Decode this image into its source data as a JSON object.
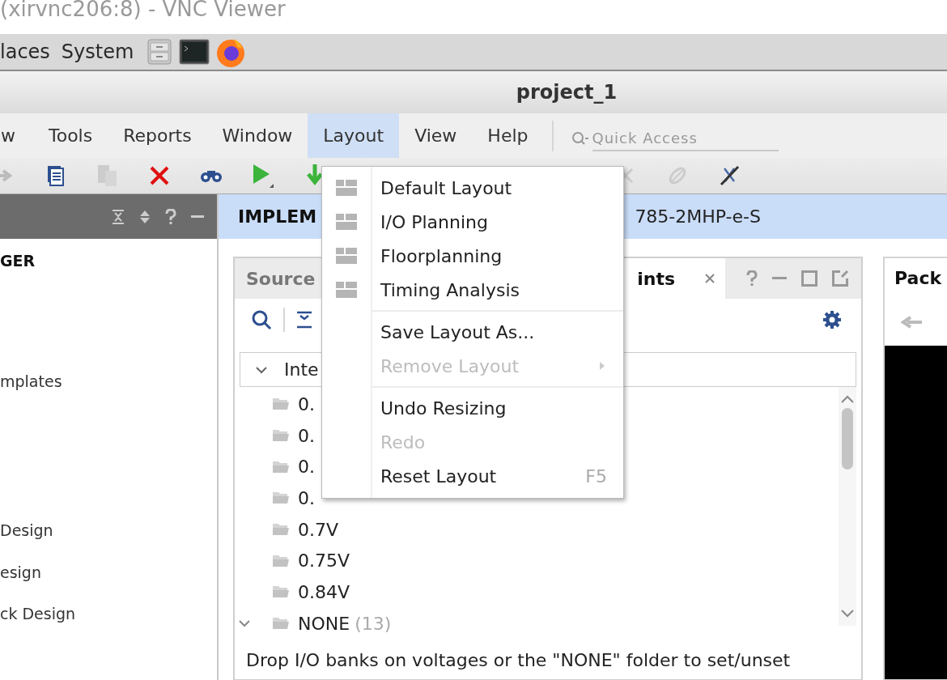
{
  "viewer_title": "(xirvnc206:8) - VNC Viewer",
  "panel_menu": [
    "laces",
    "System"
  ],
  "app_title": "project_1",
  "menubar": [
    {
      "label": "w",
      "selected": false
    },
    {
      "label": "Tools",
      "selected": false
    },
    {
      "label": "Reports",
      "selected": false
    },
    {
      "label": "Window",
      "selected": false
    },
    {
      "label": "Layout",
      "selected": true
    },
    {
      "label": "View",
      "selected": false
    },
    {
      "label": "Help",
      "selected": false
    }
  ],
  "quick_access": {
    "placeholder": "Quick Access"
  },
  "flow_navigator": {
    "items": [
      {
        "kind": "heading",
        "label": "GER"
      },
      {
        "kind": "item",
        "label": "mplates"
      },
      {
        "kind": "item",
        "label": "Design"
      },
      {
        "kind": "item",
        "label": "esign"
      },
      {
        "kind": "item",
        "label": "ck Design"
      }
    ]
  },
  "banner": {
    "left": "IMPLEM",
    "right": "785-2MHP-e-S"
  },
  "io_panel": {
    "tabs": [
      {
        "label": "Source",
        "selected": false
      },
      {
        "label": "ints",
        "selected": true
      }
    ],
    "tree": {
      "header": "Inte",
      "expanded": true,
      "items": [
        {
          "label": "0.",
          "expanded": false
        },
        {
          "label": "0.",
          "expanded": false
        },
        {
          "label": "0.",
          "expanded": false
        },
        {
          "label": "0.",
          "expanded": false
        },
        {
          "label": "0.7V",
          "expanded": false
        },
        {
          "label": "0.75V",
          "expanded": false
        },
        {
          "label": "0.84V",
          "expanded": false
        },
        {
          "label": "NONE",
          "count": "(13)",
          "expanded": true
        }
      ]
    },
    "hint": "Drop I/O banks on voltages or the \"NONE\" folder to set/unset"
  },
  "right_panel": {
    "tab": "Pack"
  },
  "layout_menu": {
    "items": [
      {
        "kind": "layout",
        "label": "Default Layout"
      },
      {
        "kind": "layout",
        "label": "I/O Planning"
      },
      {
        "kind": "layout",
        "label": "Floorplanning"
      },
      {
        "kind": "layout",
        "label": "Timing Analysis"
      },
      {
        "kind": "separator"
      },
      {
        "kind": "action",
        "label": "Save Layout As...",
        "disabled": false
      },
      {
        "kind": "submenu",
        "label": "Remove Layout",
        "disabled": true
      },
      {
        "kind": "separator"
      },
      {
        "kind": "action",
        "label": "Undo Resizing",
        "disabled": false
      },
      {
        "kind": "action",
        "label": "Redo",
        "disabled": true
      },
      {
        "kind": "action",
        "label": "Reset Layout",
        "shortcut": "F5",
        "disabled": false
      }
    ]
  }
}
